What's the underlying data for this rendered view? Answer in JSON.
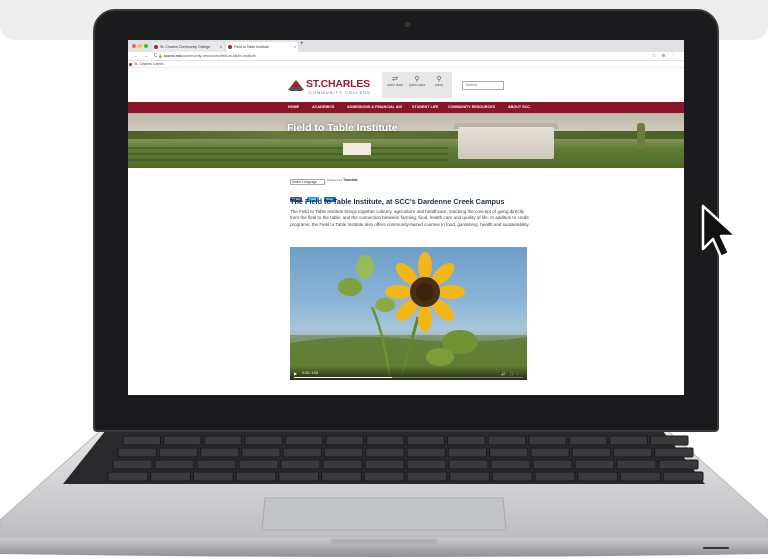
{
  "browser": {
    "tabs": [
      {
        "label": "St. Charles Community College"
      },
      {
        "label": "Field to Table Institute"
      }
    ],
    "new_tab": "+",
    "nav_icons": "←  →  C",
    "url_prefix": "sccmo.edu",
    "url_path": "/community-resources/field-to-table-institute",
    "bookmark": "St. Charles Comm..."
  },
  "site": {
    "logo_name": "ST.CHARLES",
    "logo_sub": "COMMUNITY COLLEGE",
    "quick_links": [
      {
        "icon": "directions-icon",
        "glyph": "⇄",
        "label": "APPLY NOW"
      },
      {
        "icon": "link-icon",
        "glyph": "🔗",
        "label": "QUICK LINKS"
      },
      {
        "icon": "link-icon",
        "glyph": "🔗",
        "label": "VISITS"
      }
    ],
    "search_placeholder": "Search",
    "nav": [
      "HOME",
      "ACADEMICS",
      "ADMISSIONS & FINANCIAL AID",
      "STUDENT LIFE",
      "COMMUNITY RESOURCES",
      "ABOUT SCC"
    ],
    "hero_title": "Field to Table Institute",
    "language_select": "Select Language",
    "powered_by": "Powered by",
    "powered_brand": "Translate",
    "share_buttons": [
      "Share",
      "Tweet",
      "Share"
    ],
    "heading": "The Field to Table Institute, at SCC's Dardenne Creek Campus",
    "paragraph": "The Field to Table Institute brings together culinary, agriculture and healthcare, teaching the concept of going directly from the field to the table, and the connection between farming, food, health care and quality of life. In addition to credit programs, the Field to Table Institute also offers community-based courses in food, gardening, health and sustainability.",
    "video": {
      "time": "0:28 / 1:05",
      "progress": 0.43
    },
    "accessibility_glyph": "♿"
  },
  "colors": {
    "brand": "#9b1c2e",
    "nav": "#8a1428",
    "heading": "#1f2f4f"
  }
}
